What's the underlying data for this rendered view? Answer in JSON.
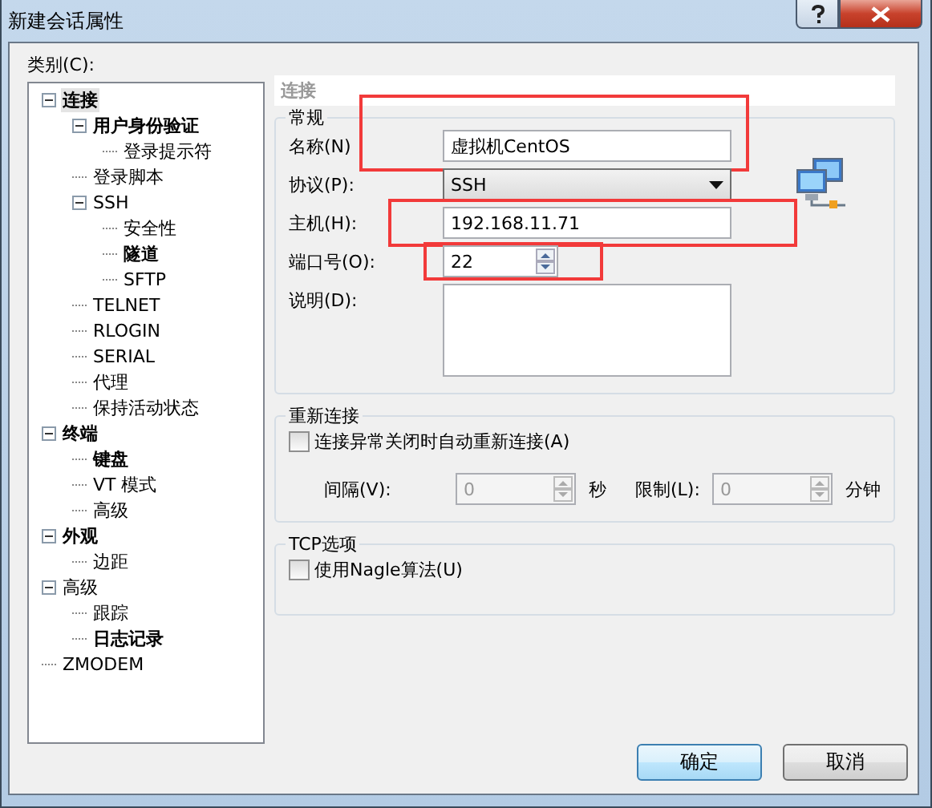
{
  "window": {
    "title": "新建会话属性"
  },
  "category_label": "类别(C):",
  "tree": [
    {
      "label": "连接",
      "bold": true,
      "selected": true,
      "expanded": true,
      "children": [
        {
          "label": "用户身份验证",
          "bold": true,
          "selected": false,
          "expanded": true,
          "children": [
            {
              "label": "登录提示符",
              "bold": false,
              "selected": false
            }
          ]
        },
        {
          "label": "登录脚本",
          "bold": false,
          "selected": false
        },
        {
          "label": "SSH",
          "bold": false,
          "selected": false,
          "expanded": true,
          "children": [
            {
              "label": "安全性",
              "bold": false,
              "selected": false
            },
            {
              "label": "隧道",
              "bold": true,
              "selected": false
            },
            {
              "label": "SFTP",
              "bold": false,
              "selected": false
            }
          ]
        },
        {
          "label": "TELNET",
          "bold": false,
          "selected": false
        },
        {
          "label": "RLOGIN",
          "bold": false,
          "selected": false
        },
        {
          "label": "SERIAL",
          "bold": false,
          "selected": false
        },
        {
          "label": "代理",
          "bold": false,
          "selected": false
        },
        {
          "label": "保持活动状态",
          "bold": false,
          "selected": false
        }
      ]
    },
    {
      "label": "终端",
      "bold": true,
      "selected": false,
      "expanded": true,
      "children": [
        {
          "label": "键盘",
          "bold": true,
          "selected": false
        },
        {
          "label": "VT 模式",
          "bold": false,
          "selected": false
        },
        {
          "label": "高级",
          "bold": false,
          "selected": false
        }
      ]
    },
    {
      "label": "外观",
      "bold": true,
      "selected": false,
      "expanded": true,
      "children": [
        {
          "label": "边距",
          "bold": false,
          "selected": false
        }
      ]
    },
    {
      "label": "高级",
      "bold": false,
      "selected": false,
      "expanded": true,
      "children": [
        {
          "label": "跟踪",
          "bold": false,
          "selected": false
        },
        {
          "label": "日志记录",
          "bold": true,
          "selected": false
        }
      ]
    },
    {
      "label": "ZMODEM",
      "bold": false,
      "selected": false
    }
  ],
  "panel_title": "连接",
  "general": {
    "title": "常规",
    "fields": [
      {
        "kind": "text",
        "label": "名称(N)",
        "value": "虚拟机CentOS",
        "highlighted": true
      },
      {
        "kind": "select",
        "label": "协议(P):",
        "value": "SSH",
        "highlighted": false
      },
      {
        "kind": "text",
        "label": "主机(H):",
        "value": "192.168.11.71",
        "highlighted": true
      },
      {
        "kind": "spin",
        "label": "端口号(O):",
        "value": "22",
        "highlighted": true
      },
      {
        "kind": "textarea",
        "label": "说明(D):",
        "highlighted": false
      }
    ]
  },
  "reconnect": {
    "title": "重新连接",
    "checkbox": {
      "label": "连接异常关闭时自动重新连接(A)",
      "checked": false
    },
    "interval": {
      "label": "间隔(V):",
      "value": "0",
      "unit": "秒",
      "disabled": true
    },
    "limit": {
      "label": "限制(L):",
      "value": "0",
      "unit": "分钟",
      "disabled": true
    }
  },
  "tcp": {
    "title": "TCP选项",
    "checkbox": {
      "label": "使用Nagle算法(U)",
      "checked": false
    }
  },
  "buttons": [
    {
      "label": "确定",
      "default": true
    },
    {
      "label": "取消",
      "default": false
    }
  ]
}
